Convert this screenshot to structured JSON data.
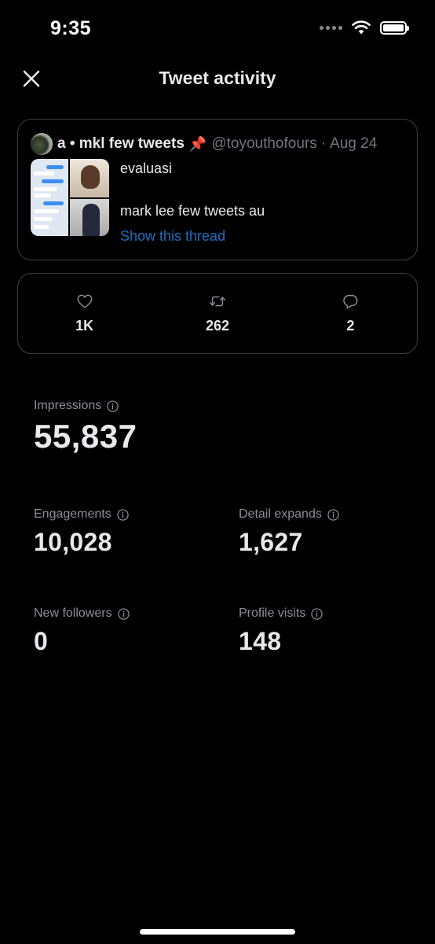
{
  "status_bar": {
    "time": "9:35"
  },
  "header": {
    "title": "Tweet activity"
  },
  "tweet": {
    "author": "a • mkl few tweets",
    "handle": "@toyouthofours",
    "separator": "·",
    "date": "Aug 24",
    "line1": "evaluasi",
    "line2": "mark lee few tweets au",
    "show_thread": "Show this thread"
  },
  "engagement": {
    "likes": "1K",
    "retweets": "262",
    "replies": "2"
  },
  "metrics": {
    "impressions": {
      "label": "Impressions",
      "value": "55,837"
    },
    "engagements": {
      "label": "Engagements",
      "value": "10,028"
    },
    "detail_expands": {
      "label": "Detail expands",
      "value": "1,627"
    },
    "new_followers": {
      "label": "New followers",
      "value": "0"
    },
    "profile_visits": {
      "label": "Profile visits",
      "value": "148"
    }
  },
  "colors": {
    "background": "#000000",
    "text": "#e7e9ea",
    "muted": "#71767b",
    "link": "#1d6fbf",
    "border": "#3a3f44"
  },
  "icons": [
    "close-icon",
    "pin-icon",
    "heart-icon",
    "retweet-icon",
    "reply-icon",
    "info-icon",
    "wifi-icon",
    "battery-icon"
  ]
}
